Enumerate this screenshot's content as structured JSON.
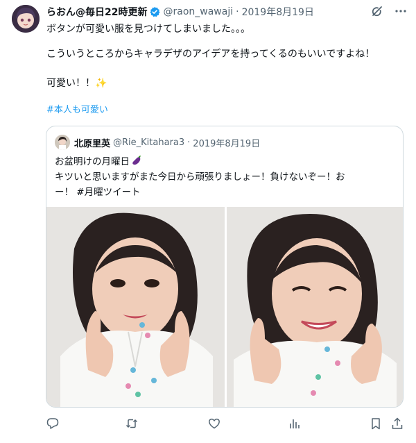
{
  "tweet": {
    "display_name": "らおん@毎日22時更新",
    "handle": "@raon_wawaji",
    "separator": "·",
    "date": "2019年8月19日",
    "lines": [
      "ボタンが可愛い服を見つけてしまいました。。。",
      "こういうところからキャラデザのアイデアを持ってくるのもいいですよね！",
      "可愛い！！✨"
    ],
    "hashtag": "#本人も可愛い",
    "verified_color": "#1d9bf0"
  },
  "quote": {
    "display_name": "北原里英",
    "handle": "@Rie_Kitahara3",
    "separator": "·",
    "date": "2019年8月19日",
    "line1": "お盆明けの月曜日",
    "line2": "キツいと思いますがまた今日から頑張りましょー！負けないぞー！お",
    "line3": "ー！ #月曜ツイート"
  },
  "icons": {
    "top": [
      "grok-icon",
      "more-icon"
    ],
    "bottom": [
      "reply-icon",
      "retweet-icon",
      "like-icon",
      "views-icon",
      "bookmark-icon",
      "share-icon"
    ]
  },
  "colors": {
    "text": "#0f1419",
    "secondary": "#536471",
    "link": "#1d9bf0",
    "border": "#cfd9de"
  }
}
